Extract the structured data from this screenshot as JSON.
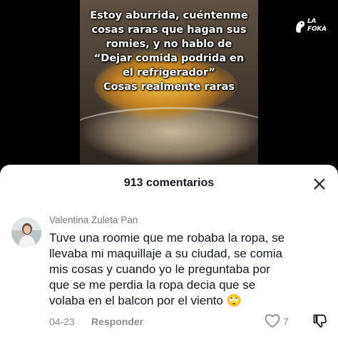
{
  "video": {
    "overlay_lines": [
      "Estoy aburrida, cuéntenme",
      "cosas raras que hagan sus",
      "romies, y no hablo de",
      "“Dejar comida podrida en",
      "el refrigerador”",
      "Cosas realmente raras"
    ],
    "logo": {
      "line1": "LA",
      "line2": "FOKA"
    }
  },
  "comments_panel": {
    "title": "913 comentarios",
    "close_icon": "close-icon"
  },
  "comment": {
    "username": "Valentina Zuleta Pan",
    "text_lines": [
      "Tuve una roomie que me robaba la ropa, se",
      "llevaba mi maquillaje a su ciudad, se comia",
      "mis cosas y cuando yo le preguntaba por",
      "que se me perdia la ropa decia que se",
      "volaba en el balcon por el viento 🙄"
    ],
    "date": "04-23",
    "reply_label": "Responder",
    "like_count": "7",
    "icons": {
      "like": "heart-outline-icon",
      "dislike": "thumbs-down-icon"
    }
  },
  "colors": {
    "primary_text": "#161823",
    "secondary_text": "#8a8b91"
  }
}
